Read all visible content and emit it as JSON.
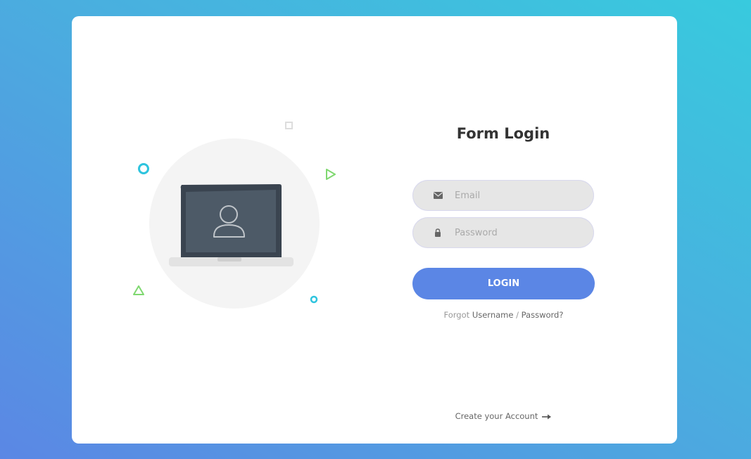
{
  "form": {
    "title": "Form Login",
    "email_placeholder": "Email",
    "password_placeholder": "Password",
    "login_label": "LOGIN",
    "forgot_prefix": "Forgot",
    "forgot_username": "Username",
    "forgot_separator": " / ",
    "forgot_password": "Password?",
    "create_account_label": "Create your Account"
  },
  "icons": {
    "email": "envelope-icon",
    "password": "lock-icon",
    "create_account": "arrow-right-icon",
    "illustration": "laptop-user-icon"
  },
  "colors": {
    "background_start": "#5b87e4",
    "background_end": "#38cade",
    "button": "#5b86e5",
    "input_background": "#e6e6e6",
    "title": "#333333"
  }
}
